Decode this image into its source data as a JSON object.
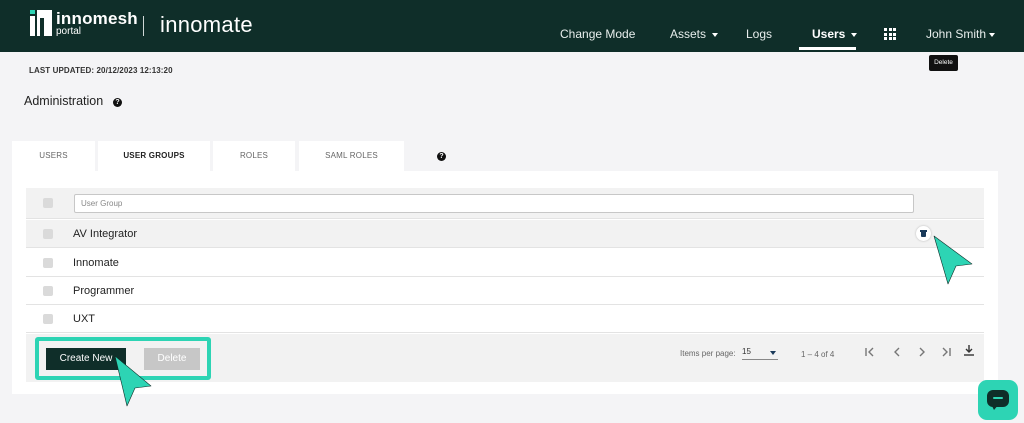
{
  "header": {
    "brand_name": "innomesh",
    "brand_sub": "portal",
    "app_name": "innomate",
    "nav": {
      "change_mode": "Change Mode",
      "assets": "Assets",
      "logs": "Logs",
      "users": "Users",
      "user_name": "John Smith"
    }
  },
  "meta": {
    "last_updated": "LAST UPDATED: 20/12/2023 12:13:20"
  },
  "page": {
    "title": "Administration",
    "help_glyph": "?"
  },
  "tabs": [
    {
      "label": "USERS"
    },
    {
      "label": "USER GROUPS"
    },
    {
      "label": "ROLES"
    },
    {
      "label": "SAML ROLES"
    }
  ],
  "table": {
    "filter_placeholder": "User Group",
    "rows": [
      {
        "name": "AV Integrator"
      },
      {
        "name": "Innomate"
      },
      {
        "name": "Programmer"
      },
      {
        "name": "UXT"
      }
    ],
    "tooltip": "Delete"
  },
  "footer": {
    "create_label": "Create New",
    "delete_label": "Delete",
    "items_per_page_label": "Items per page:",
    "items_per_page_value": "15",
    "range_label": "1 – 4 of 4"
  },
  "colors": {
    "header_bg": "#0f2e29",
    "accent": "#2dd4b4"
  }
}
